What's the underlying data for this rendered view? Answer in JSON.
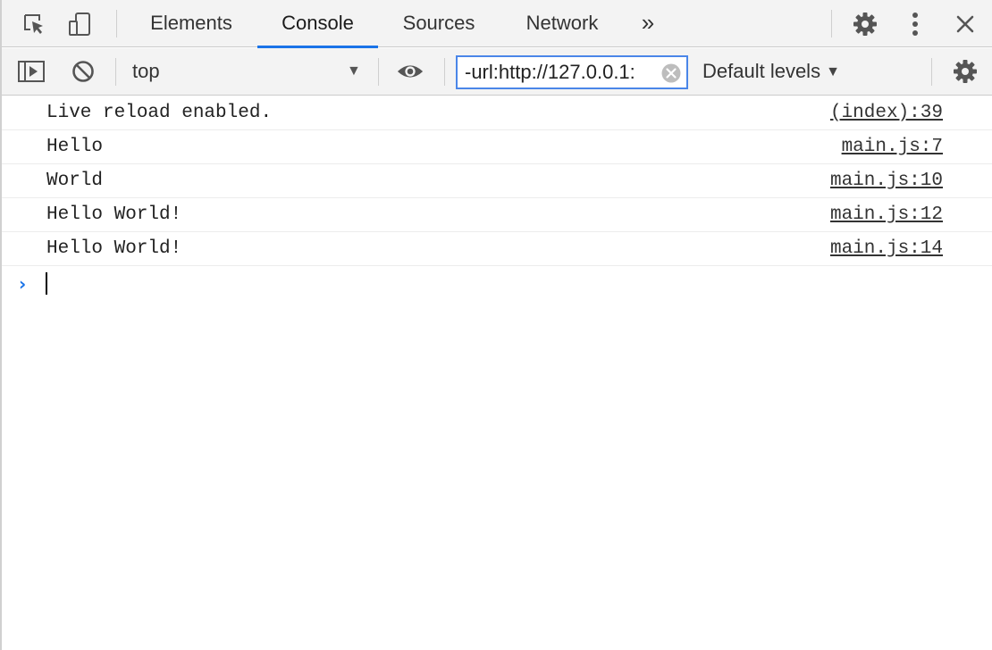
{
  "tabs": [
    {
      "label": "Elements"
    },
    {
      "label": "Console"
    },
    {
      "label": "Sources"
    },
    {
      "label": "Network"
    }
  ],
  "more_tabs": "»",
  "context_selector": {
    "value": "top"
  },
  "filter": {
    "value": "-url:http://127.0.0.1:"
  },
  "levels": {
    "label": "Default levels"
  },
  "messages": [
    {
      "text": "Live reload enabled.",
      "source": "(index):39"
    },
    {
      "text": "Hello",
      "source": "main.js:7"
    },
    {
      "text": "World",
      "source": "main.js:10"
    },
    {
      "text": "Hello World!",
      "source": "main.js:12"
    },
    {
      "text": "Hello World!",
      "source": "main.js:14"
    }
  ],
  "colors": {
    "accent": "#1a73e8",
    "toolbar_bg": "#f3f3f3"
  }
}
